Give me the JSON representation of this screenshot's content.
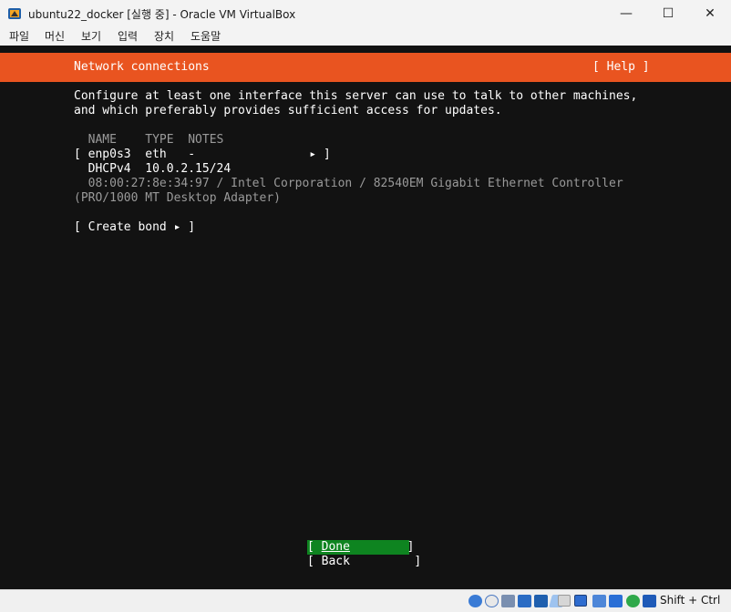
{
  "window": {
    "title": "ubuntu22_docker [실행 중] - Oracle VM VirtualBox",
    "minimize_glyph": "—",
    "maximize_glyph": "☐",
    "close_glyph": "✕"
  },
  "menu": {
    "items": [
      "파일",
      "머신",
      "보기",
      "입력",
      "장치",
      "도움말"
    ]
  },
  "installer": {
    "title": "Network connections",
    "help": "[ Help ]",
    "description_line1": "Configure at least one interface this server can use to talk to other machines,",
    "description_line2": "and which preferably provides sufficient access for updates.",
    "columns_header": "  NAME    TYPE  NOTES",
    "interface_row": "[ enp0s3  eth   -                ▸ ]",
    "dhcp_row": "  DHCPv4  10.0.2.15/24",
    "hw_line1": "  08:00:27:8e:34:97 / Intel Corporation / 82540EM Gigabit Ethernet Controller",
    "hw_line2": "(PRO/1000 MT Desktop Adapter)",
    "create_bond": "[ Create bond ▸ ]",
    "done_prefix": "[ ",
    "done_label": "Done",
    "done_suffix": "        ]",
    "back_label": "[ Back         ]"
  },
  "statusbar": {
    "hostkey": "Shift + Ctrl",
    "icons": [
      "hdd-icon",
      "optical-drive-icon",
      "audio-icon",
      "network-icon",
      "usb-icon",
      "shared-folder-icon",
      "display-icon",
      "recording-icon",
      "vm-state-icon",
      "cpu-icon",
      "mouse-integration-icon",
      "host-key-icon"
    ]
  },
  "colors": {
    "accent": "#e95420",
    "done_button": "#0e8420",
    "console_bg": "#121212"
  }
}
